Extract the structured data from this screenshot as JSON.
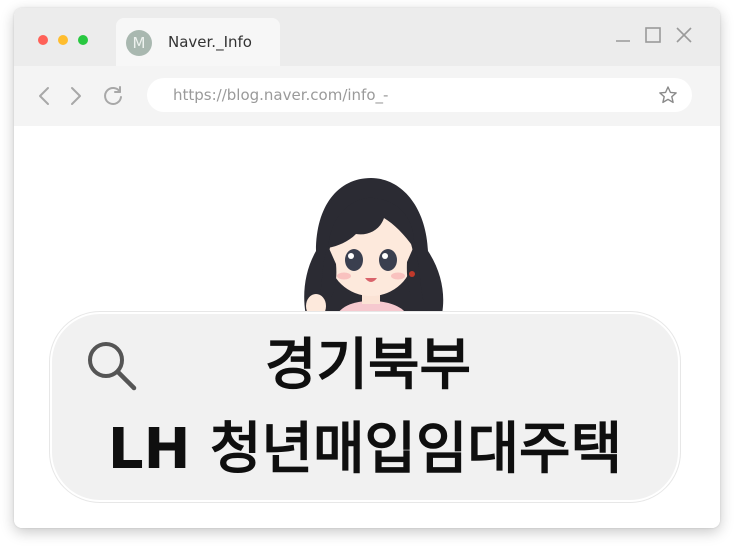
{
  "window": {
    "controls": {
      "close_color": "#ff6158",
      "minimize_color": "#ffbd2e",
      "maximize_color": "#28c840"
    }
  },
  "tab": {
    "avatar_letter": "M",
    "title": "Naver._Info"
  },
  "navbar": {
    "url": "https://blog.naver.com/info_-",
    "icons": [
      "back-icon",
      "forward-icon",
      "reload-icon",
      "bookmark-star-icon"
    ]
  },
  "search": {
    "headline_line1": "경기북부",
    "headline_line2": "LH 청년매입임대주택"
  },
  "colors": {
    "titlebar_bg": "#ececec",
    "navbar_bg": "#f4f4f4",
    "searchbox_bg": "#f1f1f1",
    "headline_text": "#0f0f0f"
  }
}
